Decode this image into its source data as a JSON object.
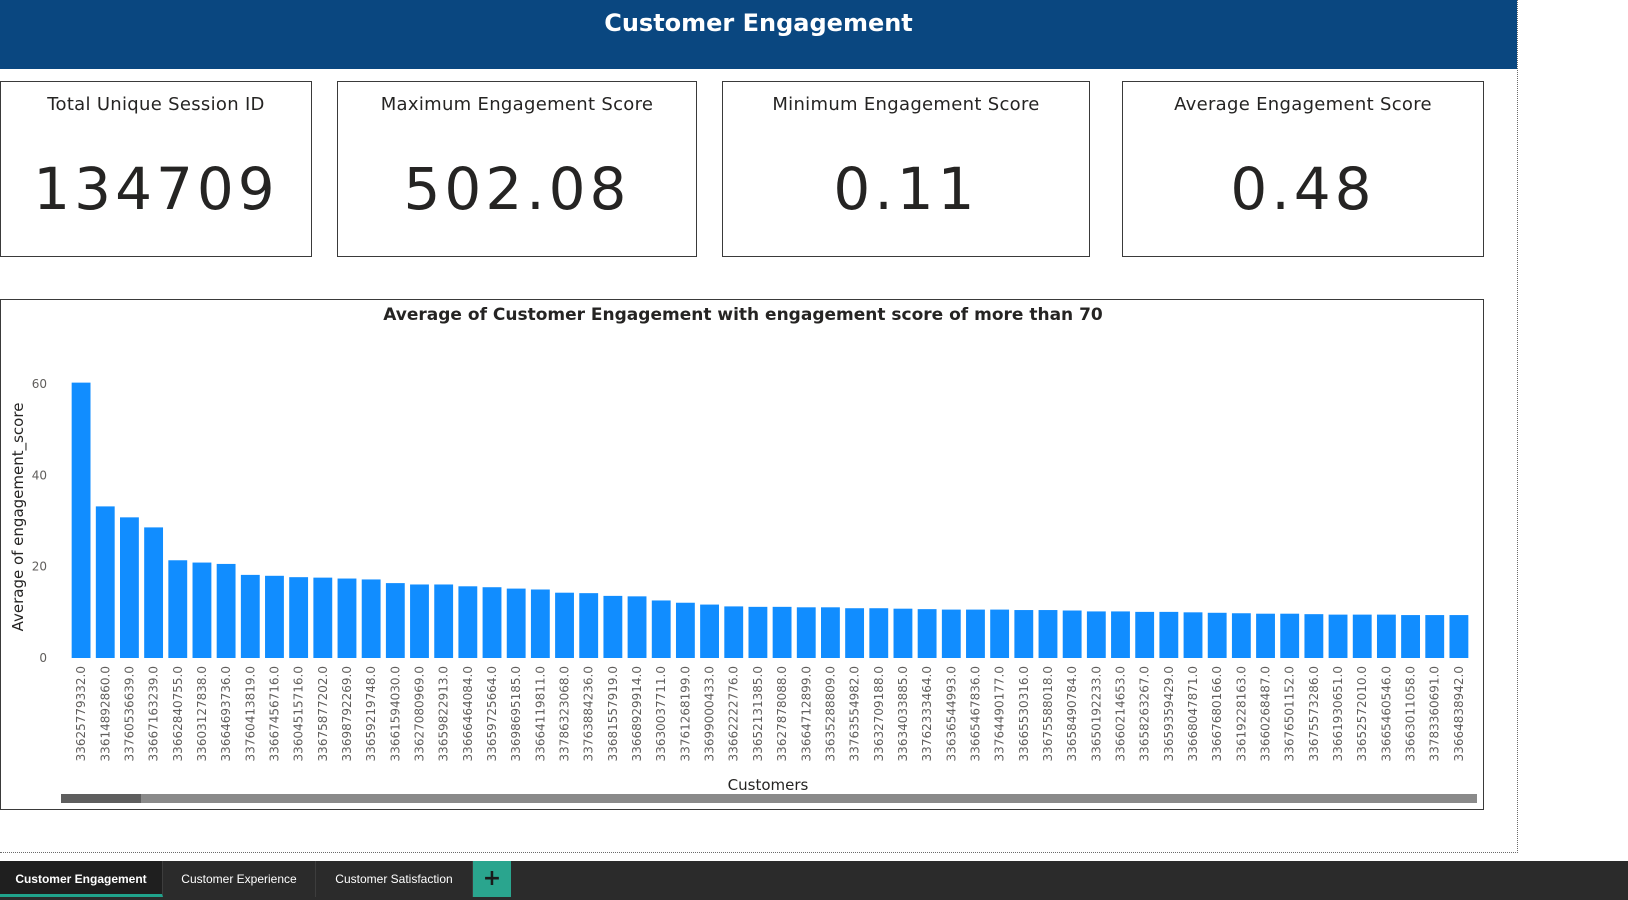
{
  "header": {
    "title": "Customer Engagement"
  },
  "kpis": [
    {
      "label": "Total Unique Session ID",
      "value": "134709"
    },
    {
      "label": "Maximum Engagement Score",
      "value": "502.08"
    },
    {
      "label": "Minimum Engagement Score",
      "value": "0.11"
    },
    {
      "label": "Average Engagement Score",
      "value": "0.48"
    }
  ],
  "chart_data": {
    "type": "bar",
    "title": "Average of Customer Engagement with engagement score of more than 70",
    "xlabel": "Customers",
    "ylabel": "Average of engagement_score",
    "ylim": [
      0,
      60
    ],
    "yticks": [
      0,
      20,
      40,
      60
    ],
    "grid": false,
    "legend": "none",
    "bar_color": "#118dff",
    "categories": [
      "33625779332.0",
      "33614892860.0",
      "33760536639.0",
      "33667163239.0",
      "33662840755.0",
      "33603127838.0",
      "33664693736.0",
      "33760413819.0",
      "33667456716.0",
      "33604515716.0",
      "33675877202.0",
      "33698792269.0",
      "33659219748.0",
      "33661594030.0",
      "33627080969.0",
      "33659822913.0",
      "33666464084.0",
      "33659725664.0",
      "33698695185.0",
      "33664119811.0",
      "33786323068.0",
      "33763884236.0",
      "33681557919.0",
      "33668929914.0",
      "33630037711.0",
      "33761268199.0",
      "33699000433.0",
      "33662222776.0",
      "33652131385.0",
      "33627878088.0",
      "33664712899.0",
      "33635288809.0",
      "33763554982.0",
      "33632709188.0",
      "33634033885.0",
      "33762333464.0",
      "33636544993.0",
      "33665467836.0",
      "33764490177.0",
      "33665530316.0",
      "33675588018.0",
      "33658490784.0",
      "33650192233.0",
      "33660214653.0",
      "33658263267.0",
      "33659359429.0",
      "33668047871.0",
      "33667680166.0",
      "33619228163.0",
      "33660268487.0",
      "33676501152.0",
      "33675573286.0",
      "33661930651.0",
      "33652572010.0",
      "33665460546.0",
      "33663011058.0",
      "33783360691.0",
      "33664838942.0"
    ],
    "values": [
      60.3,
      33.2,
      30.8,
      28.6,
      21.4,
      20.9,
      20.6,
      18.2,
      18.0,
      17.7,
      17.6,
      17.4,
      17.2,
      16.4,
      16.1,
      16.1,
      15.7,
      15.5,
      15.2,
      15.0,
      14.3,
      14.2,
      13.6,
      13.5,
      12.6,
      12.1,
      11.7,
      11.3,
      11.2,
      11.2,
      11.1,
      11.1,
      10.9,
      10.9,
      10.8,
      10.7,
      10.6,
      10.6,
      10.6,
      10.5,
      10.5,
      10.4,
      10.2,
      10.2,
      10.1,
      10.1,
      10.0,
      9.9,
      9.8,
      9.7,
      9.7,
      9.6,
      9.5,
      9.5,
      9.5,
      9.4,
      9.4,
      9.4
    ]
  },
  "tabs": [
    {
      "label": "Customer Engagement",
      "active": true
    },
    {
      "label": "Customer Experience",
      "active": false
    },
    {
      "label": "Customer Satisfaction",
      "active": false
    }
  ],
  "add_tab": {
    "label": "+"
  }
}
